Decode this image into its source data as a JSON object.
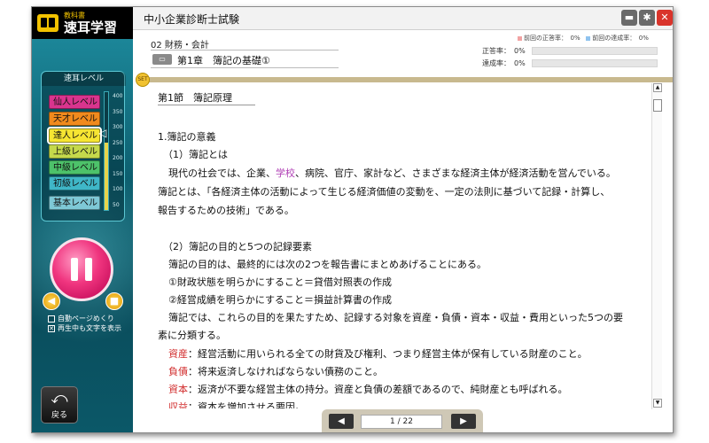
{
  "app": {
    "logo_sub": "教科書",
    "logo_main": "速耳学習",
    "title": "中小企業診断士試験"
  },
  "sidebar": {
    "level_title": "速耳レベル",
    "levels": [
      {
        "label": "仙人レベル",
        "color": "#d9348e"
      },
      {
        "label": "天才レベル",
        "color": "#f08a1d"
      },
      {
        "label": "達人レベル",
        "color": "#f6e532"
      },
      {
        "label": "上級レベル",
        "color": "#c5d94b"
      },
      {
        "label": "中級レベル",
        "color": "#4dc26a"
      },
      {
        "label": "初級レベル",
        "color": "#3fb6c7"
      },
      {
        "label": "基本レベル",
        "color": "#7ec8d6"
      }
    ],
    "selected_level": "達人レベル",
    "scale_ticks": [
      "400",
      "350",
      "300",
      "250",
      "200",
      "150",
      "100",
      "50"
    ],
    "scale_fill_fraction": 0.57,
    "auto_page_turn_label": "自動ページめくり",
    "show_text_label": "再生中も文字を表示",
    "show_text_checked": true,
    "back_label": "戻る"
  },
  "header": {
    "subject": "02 財務・会計",
    "chapter_icon_text": "▭",
    "chapter": "第1章　簿記の基礎①",
    "legend_prev_correct": "前回の正答率：　0%",
    "legend_prev_achieve": "前回の達成率：　0%",
    "legend_color_correct": "#f2a3a3",
    "legend_color_achieve": "#8fc3ef",
    "correct_label": "正答率：",
    "correct_value": "0%",
    "achieve_label": "達成率：",
    "achieve_value": "0%"
  },
  "content": {
    "section": "第1節　簿記原理",
    "h1": "1.簿記の意義",
    "h1_1": "（1）簿記とは",
    "p1_a": "現代の社会では、企業、",
    "p1_school": "学校",
    "p1_b": "、病院、官庁、家計など、さまざまな経済主体が経済活動を営んでいる。",
    "p2": "簿記とは、「各経済主体の活動によって生じる経済価値の変動を、一定の法則に基づいて記録・計算し、",
    "p3": "報告するための技術」である。",
    "h1_2": "（2）簿記の目的と5つの記録要素",
    "p4": "簿記の目的は、最終的には次の2つを報告書にまとめあげることにある。",
    "p5": "①財政状態を明らかにすること＝貸借対照表の作成",
    "p6": "②経営成績を明らかにすること＝損益計算書の作成",
    "p7": "簿記では、これらの目的を果たすため、記録する対象を資産・負債・資本・収益・費用といった5つの要",
    "p8": "素に分類する。",
    "term1": "資産",
    "def1": "：経営活動に用いられる全ての財貨及び権利、つまり経営主体が保有している財産のこと。",
    "term2": "負債",
    "def2": "：将来返済しなければならない債務のこと。",
    "term3": "資本",
    "def3": "：返済が不要な経営主体の持分。資産と負債の差額であるので、純財産とも呼ばれる。",
    "term4": "収益",
    "def4": "：資本を増加させる要因。"
  },
  "pager": {
    "prev": "◀",
    "next": "▶",
    "page_text": "1 / 22"
  },
  "window_buttons": {
    "folder_color": "#6a6a6a",
    "settings_color": "#6a6a6a",
    "close_color": "#d9342b"
  }
}
